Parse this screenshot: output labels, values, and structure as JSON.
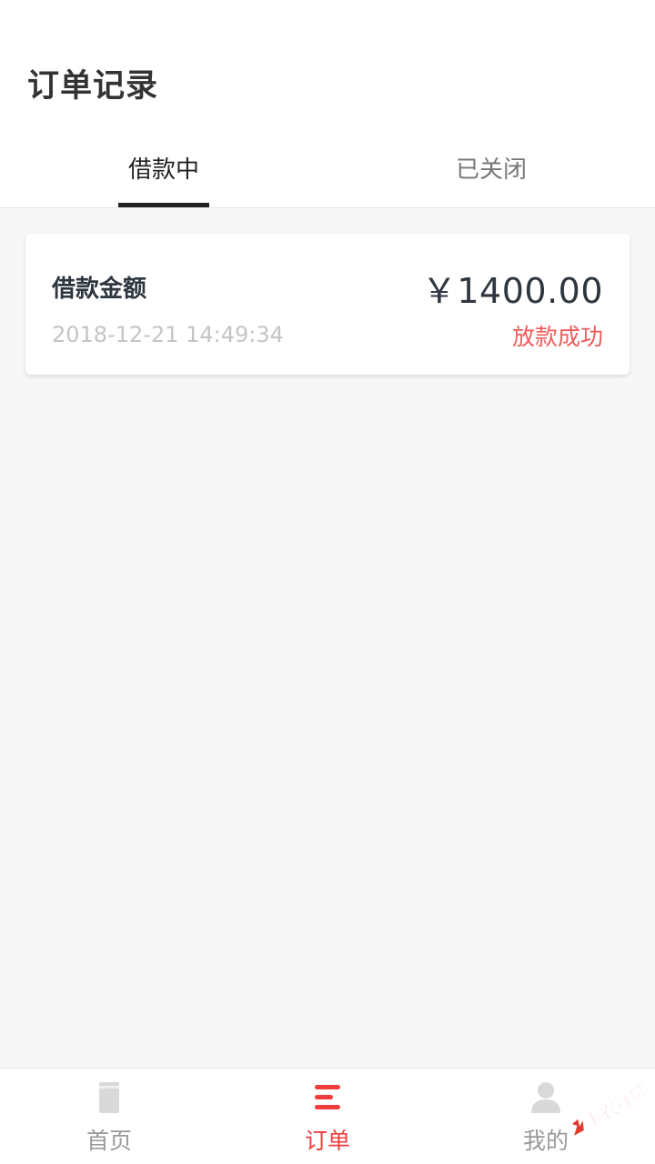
{
  "header": {
    "title": "订单记录",
    "tabs": [
      {
        "label": "借款中",
        "active": true
      },
      {
        "label": "已关闭",
        "active": false
      }
    ]
  },
  "orders": [
    {
      "label": "借款金额",
      "amount": "￥1400.00",
      "datetime": "2018-12-21 14:49:34",
      "status": "放款成功",
      "status_color": "#f15b5b"
    }
  ],
  "tabbar": {
    "items": [
      {
        "label": "首页",
        "icon": "document-icon",
        "active": false
      },
      {
        "label": "订单",
        "icon": "list-icon",
        "active": true
      },
      {
        "label": "我的",
        "icon": "user-icon",
        "active": false
      }
    ],
    "active_color": "#f03c3c",
    "inactive_color": "#999999"
  },
  "watermark": {
    "text": "卡农社区"
  }
}
